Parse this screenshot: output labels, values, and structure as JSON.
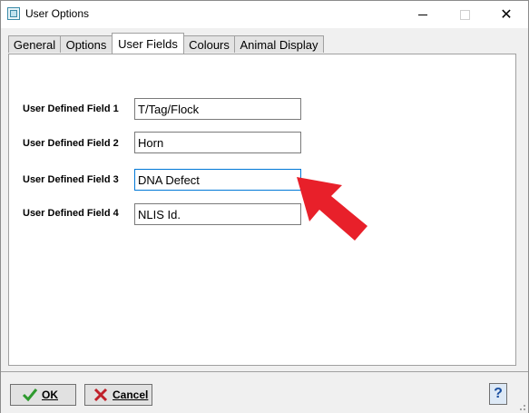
{
  "window": {
    "title": "User Options"
  },
  "tabs": [
    {
      "label": "General"
    },
    {
      "label": "Options"
    },
    {
      "label": "User Fields",
      "active": true
    },
    {
      "label": "Colours"
    },
    {
      "label": "Animal Display"
    }
  ],
  "fields": [
    {
      "label": "User Defined Field 1",
      "value": "T/Tag/Flock"
    },
    {
      "label": "User Defined Field 2",
      "value": "Horn"
    },
    {
      "label": "User Defined Field 3",
      "value": "DNA Defect"
    },
    {
      "label": "User Defined Field 4",
      "value": "NLIS Id."
    }
  ],
  "buttons": {
    "ok_label": "OK",
    "cancel_label": "Cancel",
    "help_label": "?"
  },
  "colors": {
    "focus_border": "#0078d7",
    "annotation_arrow": "#e8202a",
    "ok_check": "#2e9a2e",
    "cancel_x": "#c0202a"
  },
  "icons": [
    "app-icon",
    "minimize-icon",
    "maximize-icon",
    "close-icon",
    "checkmark-icon",
    "x-icon",
    "help-icon",
    "arrow-annotation",
    "resize-grip-icon"
  ]
}
